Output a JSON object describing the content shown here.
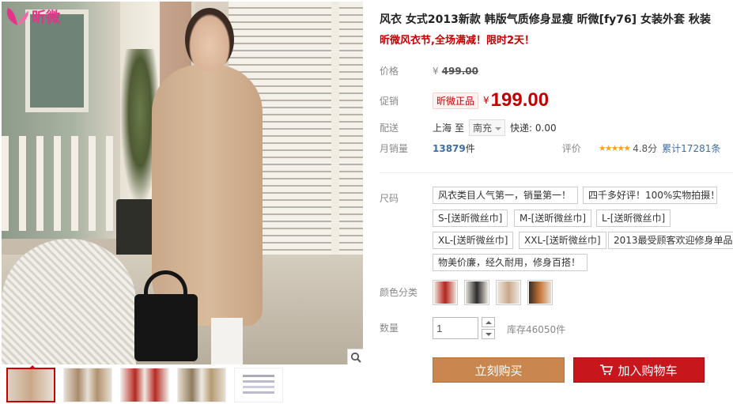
{
  "brand": {
    "logo_text": "昕微",
    "logo_icon": "butterfly-wing-icon",
    "logo_color": "#e5338a"
  },
  "gallery": {
    "zoom_icon": "magnifier-icon",
    "thumbnails": [
      {
        "name": "thumb-beige-coat",
        "selected": true
      },
      {
        "name": "thumb-coat-back"
      },
      {
        "name": "thumb-red-coat"
      },
      {
        "name": "thumb-khaki-coat"
      },
      {
        "name": "thumb-size-chart"
      }
    ]
  },
  "product": {
    "title": "风衣 女式2013新款 韩版气质修身显瘦 昕微[fy76] 女装外套 秋装",
    "promo": "昕微风衣节,全场满减！限时2天！"
  },
  "price": {
    "label": "价格",
    "currency": "¥",
    "original": "499.00"
  },
  "promo_price": {
    "label": "促销",
    "tag": "昕微正品",
    "currency": "¥",
    "value": "199.00"
  },
  "shipping": {
    "label": "配送",
    "from": "上海",
    "to_word": "至",
    "destination": "南充",
    "express": "快递: 0.00"
  },
  "sales": {
    "label": "月销量",
    "count": "13879",
    "unit": "件",
    "rating_label": "评价",
    "stars": "★★★★★",
    "score": "4.8分",
    "reviews": "累计17281条"
  },
  "size": {
    "label": "尺码",
    "options": [
      "风衣类目人气第一，销量第一！",
      "四千多好评！100%实物拍摄！",
      "S-[送昕微丝巾]",
      "M-[送昕微丝巾]",
      "L-[送昕微丝巾]",
      "XL-[送昕微丝巾]",
      "XXL-[送昕微丝巾]",
      "2013最受顾客欢迎修身单品",
      "物美价廉，经久耐用，修身百搭！"
    ]
  },
  "color": {
    "label": "颜色分类",
    "swatches": [
      "#b3261e",
      "#2b2b2b",
      "#c9a88a",
      "#c9783a"
    ]
  },
  "quantity": {
    "label": "数量",
    "value": "1",
    "stock": "库存46050件"
  },
  "actions": {
    "buy_now": "立刻购买",
    "add_to_cart": "加入购物车",
    "cart_icon": "shopping-cart-icon",
    "buy_color": "#c9874f",
    "cart_color": "#c8161d"
  }
}
